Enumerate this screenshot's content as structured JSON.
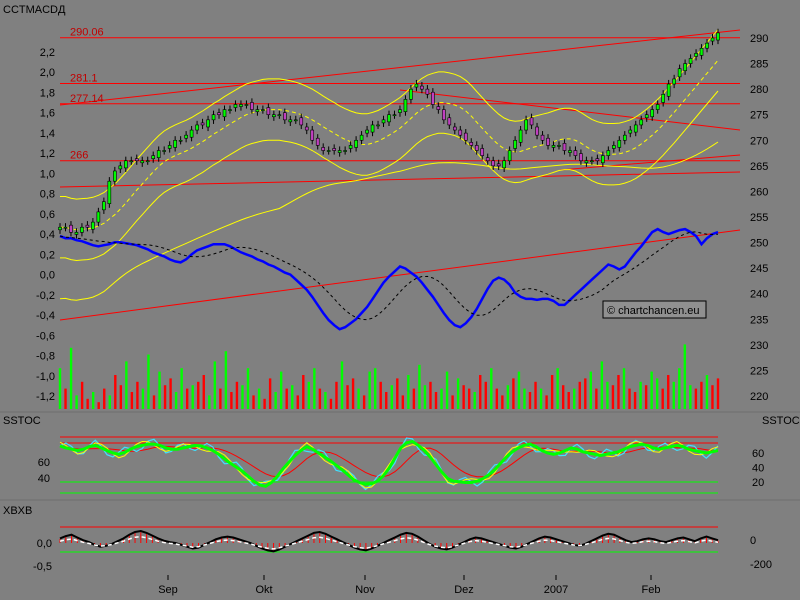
{
  "panels": {
    "main": {
      "title": "CCTMACDД",
      "left_ticks": [
        "2,2",
        "2,0",
        "1,8",
        "1,6",
        "1,4",
        "1,2",
        "1,0",
        "0,8",
        "0,6",
        "0,4",
        "0,2",
        "0,0",
        "-0,2",
        "-0,4",
        "-0,6",
        "-0,8",
        "-1,0",
        "-1,2"
      ],
      "right_ticks": [
        "290",
        "285",
        "280",
        "275",
        "270",
        "265",
        "260",
        "255",
        "250",
        "245",
        "240",
        "235",
        "230",
        "225",
        "220"
      ],
      "hlines": [
        {
          "label": "290.06",
          "value": 290.06
        },
        {
          "label": "281.1",
          "value": 281.1
        },
        {
          "label": "277.14",
          "value": 277.14
        },
        {
          "label": "266",
          "value": 266
        }
      ],
      "watermark": "© chartchancen.eu"
    },
    "sstoc": {
      "title_left": "SSTOC",
      "title_right": "SSTOC",
      "left_ticks": [
        "60",
        "40"
      ],
      "right_ticks": [
        "60",
        "40",
        "20"
      ]
    },
    "xbxb": {
      "title": "XBXB",
      "left_ticks": [
        "0,0",
        "-0,5"
      ],
      "right_ticks": [
        "0",
        "-200"
      ]
    }
  },
  "x_axis": [
    "Sep",
    "Okt",
    "Nov",
    "Dez",
    "2007",
    "Feb"
  ],
  "colors": {
    "background": "#808080",
    "price_up": "#00ff00",
    "price_down": "#ff0000",
    "macd": "#0000ff",
    "bands": "#ffff00",
    "trend": "#ff0000",
    "stoch_green": "#00ff00",
    "stoch_cyan": "#40e0ff"
  },
  "chart_data": {
    "type": "line",
    "series": [
      {
        "values": [
          253,
          253,
          252,
          252,
          253,
          253,
          254,
          256,
          258,
          262,
          264,
          265,
          266,
          266,
          266,
          266,
          266,
          267,
          268,
          268,
          269,
          270,
          270,
          271,
          272,
          273,
          273,
          274,
          275,
          275,
          276,
          276,
          277,
          277,
          277,
          276,
          276,
          276,
          275,
          275,
          275,
          274,
          274,
          274,
          273,
          272,
          270,
          269,
          268,
          268,
          268,
          268,
          268,
          269,
          270,
          271,
          272,
          273,
          273,
          274,
          275,
          275,
          276,
          278,
          280,
          281,
          280,
          279,
          277,
          276,
          274,
          273,
          272,
          271,
          270,
          269,
          268,
          267,
          266,
          265,
          265,
          266,
          268,
          270,
          272,
          274,
          273,
          271,
          270,
          269,
          269,
          269,
          268,
          268,
          267,
          266,
          266,
          266,
          266,
          267,
          268,
          269,
          270,
          271,
          272,
          273,
          274,
          275,
          276,
          277,
          279,
          281,
          282,
          284,
          285,
          286,
          287,
          288,
          289,
          290,
          291
        ]
      },
      {
        "values": [
          0.38,
          0.36,
          0.36,
          0.34,
          0.33,
          0.31,
          0.29,
          0.28,
          0.29,
          0.3,
          0.32,
          0.32,
          0.31,
          0.3,
          0.29,
          0.27,
          0.25,
          0.22,
          0.2,
          0.18,
          0.15,
          0.13,
          0.12,
          0.15,
          0.2,
          0.24,
          0.26,
          0.28,
          0.3,
          0.3,
          0.3,
          0.28,
          0.25,
          0.22,
          0.2,
          0.18,
          0.15,
          0.13,
          0.1,
          0.08,
          0.05,
          0.02,
          0.0,
          -0.05,
          -0.1,
          -0.15,
          -0.22,
          -0.3,
          -0.38,
          -0.45,
          -0.5,
          -0.54,
          -0.52,
          -0.48,
          -0.44,
          -0.38,
          -0.32,
          -0.24,
          -0.16,
          -0.08,
          -0.02,
          0.03,
          0.08,
          0.06,
          0.02,
          -0.02,
          -0.08,
          -0.15,
          -0.22,
          -0.3,
          -0.38,
          -0.45,
          -0.5,
          -0.52,
          -0.48,
          -0.42,
          -0.34,
          -0.24,
          -0.14,
          -0.06,
          -0.03,
          -0.05,
          -0.1,
          -0.18,
          -0.22,
          -0.24,
          -0.24,
          -0.25,
          -0.24,
          -0.24,
          -0.26,
          -0.3,
          -0.3,
          -0.25,
          -0.2,
          -0.15,
          -0.1,
          -0.05,
          0.0,
          0.05,
          0.1,
          0.08,
          0.05,
          0.08,
          0.15,
          0.22,
          0.28,
          0.35,
          0.42,
          0.45,
          0.42,
          0.4,
          0.42,
          0.44,
          0.45,
          0.42,
          0.38,
          0.3,
          0.36,
          0.4,
          0.42
        ]
      }
    ],
    "volume": [
      0.6,
      0.3,
      0.9,
      0.2,
      0.4,
      0.15,
      0.25,
      0.1,
      0.3,
      0.2,
      0.5,
      0.35,
      0.7,
      0.25,
      0.4,
      0.3,
      0.8,
      0.2,
      0.55,
      0.35,
      0.45,
      0.25,
      0.6,
      0.3,
      0.35,
      0.4,
      0.5,
      0.2,
      0.7,
      0.3,
      0.85,
      0.25,
      0.4,
      0.35,
      0.6,
      0.2,
      0.3,
      0.15,
      0.45,
      0.25,
      0.55,
      0.3,
      0.35,
      0.2,
      0.5,
      0.4,
      0.6,
      0.3,
      0.25,
      0.15,
      0.4,
      0.7,
      0.35,
      0.45,
      0.3,
      0.2,
      0.55,
      0.6,
      0.4,
      0.25,
      0.35,
      0.45,
      0.2,
      0.5,
      0.3,
      0.65,
      0.35,
      0.4,
      0.25,
      0.3,
      0.55,
      0.2,
      0.45,
      0.35,
      0.3,
      0.25,
      0.5,
      0.4,
      0.6,
      0.3,
      0.2,
      0.35,
      0.45,
      0.55,
      0.3,
      0.25,
      0.4,
      0.3,
      0.2,
      0.5,
      0.6,
      0.35,
      0.25,
      0.3,
      0.4,
      0.45,
      0.55,
      0.3,
      0.7,
      0.4,
      0.35,
      0.5,
      0.6,
      0.3,
      0.25,
      0.4,
      0.35,
      0.55,
      0.45,
      0.3,
      0.5,
      0.4,
      0.6,
      0.95,
      0.35,
      0.3,
      0.4,
      0.5,
      0.35,
      0.45
    ],
    "stoch_values": [
      75,
      72,
      70,
      68,
      70,
      74,
      76,
      72,
      68,
      64,
      62,
      65,
      70,
      74,
      76,
      78,
      78,
      76,
      72,
      70,
      70,
      72,
      74,
      76,
      75,
      72,
      68,
      62,
      55,
      48,
      42,
      36,
      28,
      20,
      14,
      12,
      18,
      28,
      40,
      50,
      60,
      68,
      74,
      70,
      64,
      58,
      52,
      45,
      38,
      30,
      22,
      18,
      15,
      16,
      20,
      28,
      40,
      56,
      72,
      80,
      82,
      76,
      68,
      58,
      46,
      34,
      24,
      20,
      19,
      18,
      18,
      20,
      24,
      30,
      38,
      48,
      58,
      66,
      72,
      76,
      78,
      74,
      68,
      64,
      62,
      64,
      68,
      72,
      70,
      66,
      64,
      62,
      60,
      62,
      64,
      66,
      70,
      74,
      76,
      78,
      76,
      72,
      70,
      72,
      74,
      76,
      74,
      70,
      68,
      66,
      64,
      66,
      68
    ],
    "xbxb_values": [
      0.1,
      0.15,
      0.18,
      0.12,
      0.06,
      0.02,
      -0.04,
      -0.08,
      -0.06,
      -0.02,
      0.04,
      0.1,
      0.18,
      0.24,
      0.26,
      0.22,
      0.16,
      0.1,
      0.05,
      0.02,
      0.0,
      -0.04,
      -0.08,
      -0.12,
      -0.1,
      -0.04,
      0.02,
      0.08,
      0.12,
      0.14,
      0.12,
      0.08,
      0.04,
      0.0,
      -0.06,
      -0.12,
      -0.16,
      -0.18,
      -0.14,
      -0.08,
      -0.02,
      0.04,
      0.1,
      0.16,
      0.22,
      0.24,
      0.2,
      0.14,
      0.08,
      0.02,
      -0.04,
      -0.1,
      -0.14,
      -0.16,
      -0.12,
      -0.06,
      0.0,
      0.06,
      0.12,
      0.18,
      0.22,
      0.2,
      0.14,
      0.06,
      -0.02,
      -0.08,
      -0.12,
      -0.14,
      -0.1,
      -0.04,
      0.02,
      0.08,
      0.12,
      0.1,
      0.06,
      0.02,
      -0.02,
      -0.06,
      -0.1,
      -0.12,
      -0.08,
      -0.02,
      0.04,
      0.1,
      0.14,
      0.12,
      0.08,
      0.04,
      0.0,
      -0.04,
      -0.06,
      -0.02,
      0.04,
      0.1,
      0.16,
      0.2,
      0.18,
      0.12,
      0.06,
      0.02,
      0.04,
      0.08,
      0.1,
      0.08,
      0.04,
      0.02,
      0.06,
      0.1,
      0.12,
      0.08,
      0.04,
      0.1,
      0.14,
      0.1,
      0.06
    ]
  }
}
